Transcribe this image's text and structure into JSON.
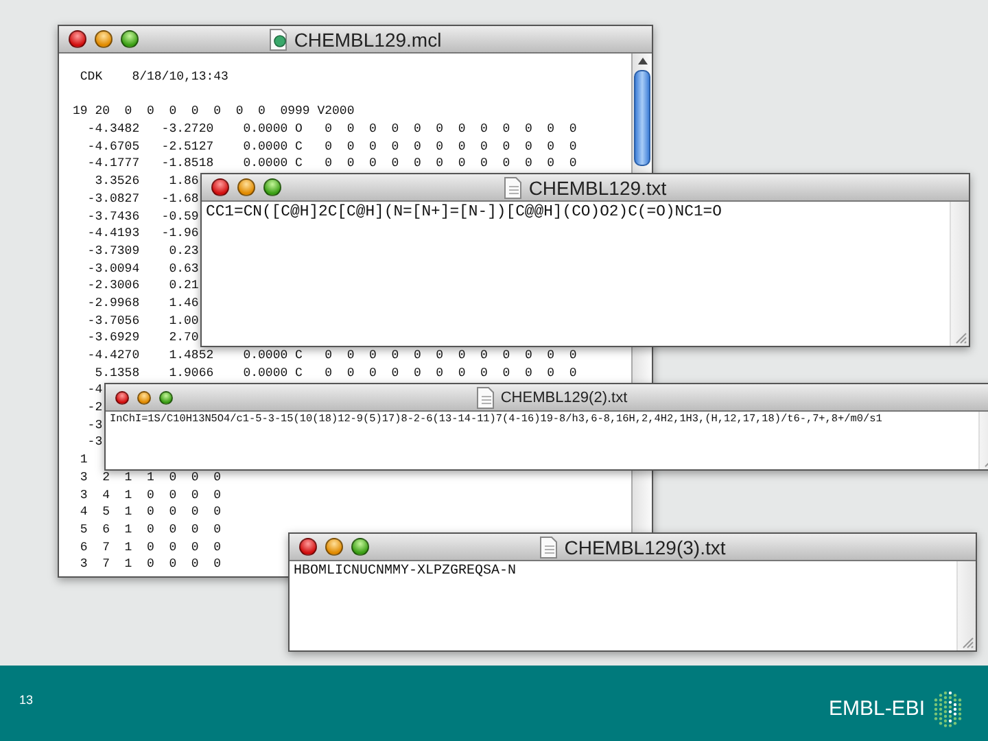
{
  "windows": [
    {
      "kind": "molfile",
      "title": "CHEMBL129.mcl",
      "header": " CDK    8/18/10,13:43",
      "counts": "19 20  0  0  0  0  0  0  0  0999 V2000",
      "atoms": [
        "  -4.3482   -3.2720    0.0000 O   0  0  0  0  0  0  0  0  0  0  0  0",
        "  -4.6705   -2.5127    0.0000 C   0  0  0  0  0  0  0  0  0  0  0  0",
        "  -4.1777   -1.8518    0.0000 C   0  0  0  0  0  0  0  0  0  0  0  0",
        "   3.3526    1.86",
        "  -3.0827   -1.68",
        "  -3.7436   -0.59",
        "  -4.4193   -1.96",
        "  -3.7309    0.23",
        "  -3.0094    0.63",
        "  -2.3006    0.21",
        "  -2.9968    1.46",
        "  -3.7056    1.00",
        "  -3.6929    2.70",
        "  -4.4270    1.4852    0.0000 C   0  0  0  0  0  0  0  0  0  0  0  0",
        "   5.1358    1.9066    0.0000 C   0  0  0  0  0  0  0  0  0  0  0  0",
        "  -4",
        "  -2",
        "  -3",
        "  -3"
      ],
      "bonds": [
        " 1",
        " 3  2  1  1  0  0  0",
        " 3  4  1  0  0  0  0",
        " 4  5  1  0  0  0  0",
        " 5  6  1  0  0  0  0",
        " 6  7  1  0  0  0  0",
        " 3  7  1  0  0  0  0"
      ]
    },
    {
      "kind": "text",
      "title": "CHEMBL129.txt",
      "text": "CC1=CN([C@H]2C[C@H](N=[N+]=[N-])[C@@H](CO)O2)C(=O)NC1=O"
    },
    {
      "kind": "text",
      "title": "CHEMBL129(2).txt",
      "text": "InChI=1S/C10H13N5O4/c1-5-3-15(10(18)12-9(5)17)8-2-6(13-14-11)7(4-16)19-8/h3,6-8,16H,2,4H2,1H3,(H,12,17,18)/t6-,7+,8+/m0/s1"
    },
    {
      "kind": "text",
      "title": "CHEMBL129(3).txt",
      "text": "HBOMLICNUCNMMY-XLPZGREQSA-N"
    }
  ],
  "footer": {
    "page_number": "13",
    "logo_text": "EMBL-EBI"
  }
}
